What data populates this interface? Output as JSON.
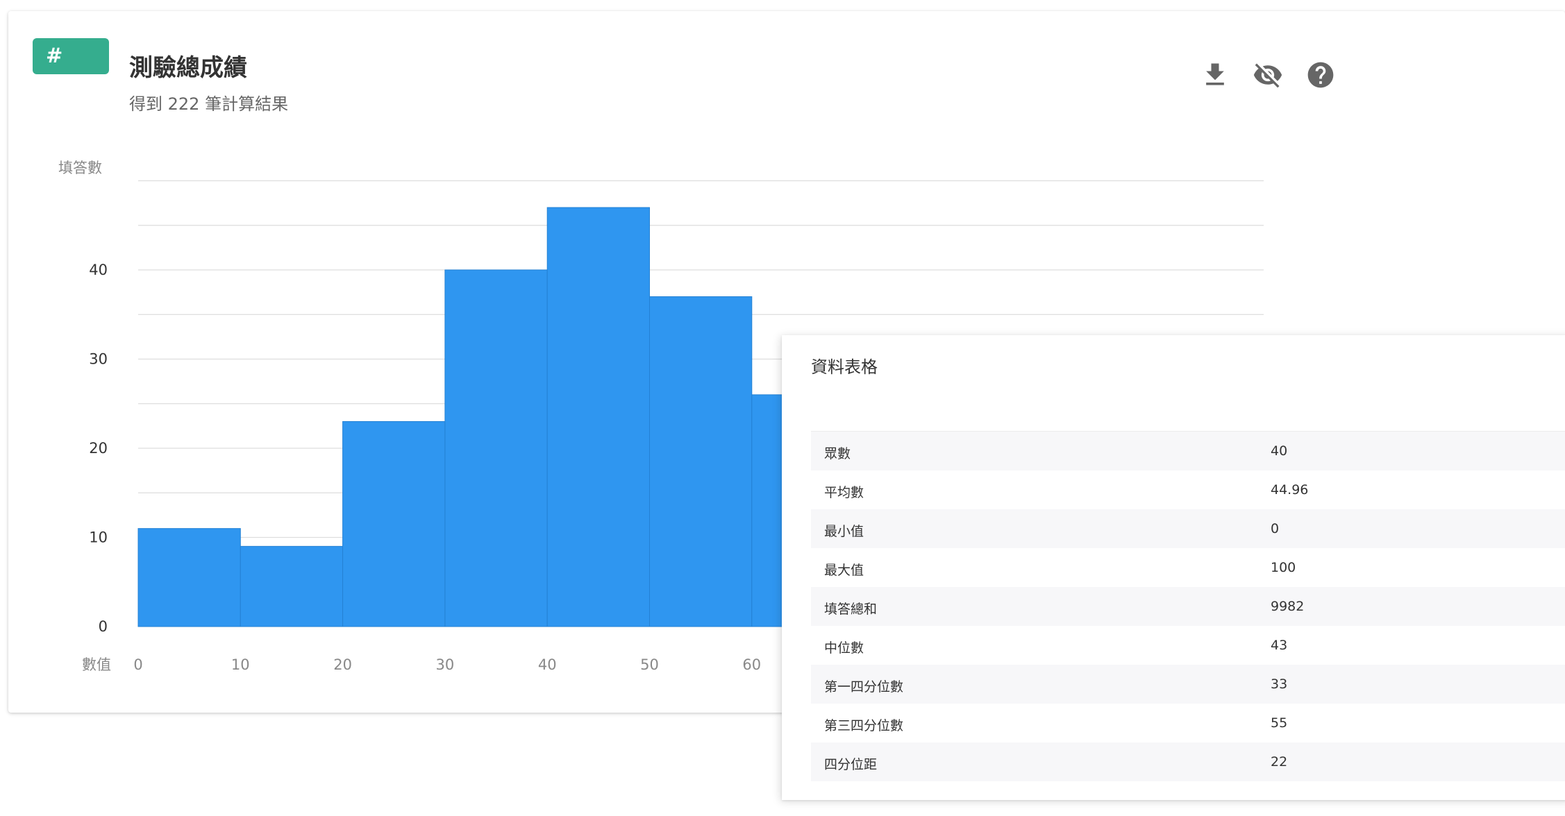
{
  "card": {
    "badge": "#",
    "title": "測驗總成績",
    "subtitle": "得到 222 筆計算結果",
    "toolbar": [
      {
        "icon": "download-icon"
      },
      {
        "icon": "eye-off-icon"
      },
      {
        "icon": "help-icon"
      }
    ]
  },
  "chart_data": {
    "type": "bar",
    "ylabel": "填答數",
    "xlabel": "數值",
    "ylim": [
      0,
      50
    ],
    "grid": true,
    "color": "#2f96f0",
    "bins": [
      {
        "start": 0,
        "end": 10,
        "value": 11
      },
      {
        "start": 10,
        "end": 20,
        "value": 9
      },
      {
        "start": 20,
        "end": 30,
        "value": 23
      },
      {
        "start": 30,
        "end": 40,
        "value": 40
      },
      {
        "start": 40,
        "end": 50,
        "value": 47
      },
      {
        "start": 50,
        "end": 60,
        "value": 37
      },
      {
        "start": 60,
        "end": 70,
        "value": 26
      }
    ],
    "yticks": [
      0,
      10,
      20,
      30,
      40
    ],
    "xticks": [
      0,
      10,
      20,
      30,
      40,
      50,
      60
    ]
  },
  "data_table": {
    "title": "資料表格",
    "rows": [
      {
        "label": "眾數",
        "value": "40"
      },
      {
        "label": "平均數",
        "value": "44.96"
      },
      {
        "label": "最小值",
        "value": "0"
      },
      {
        "label": "最大值",
        "value": "100"
      },
      {
        "label": "填答總和",
        "value": "9982"
      },
      {
        "label": "中位數",
        "value": "43"
      },
      {
        "label": "第一四分位數",
        "value": "33"
      },
      {
        "label": "第三四分位數",
        "value": "55"
      },
      {
        "label": "四分位距",
        "value": "22"
      }
    ]
  }
}
